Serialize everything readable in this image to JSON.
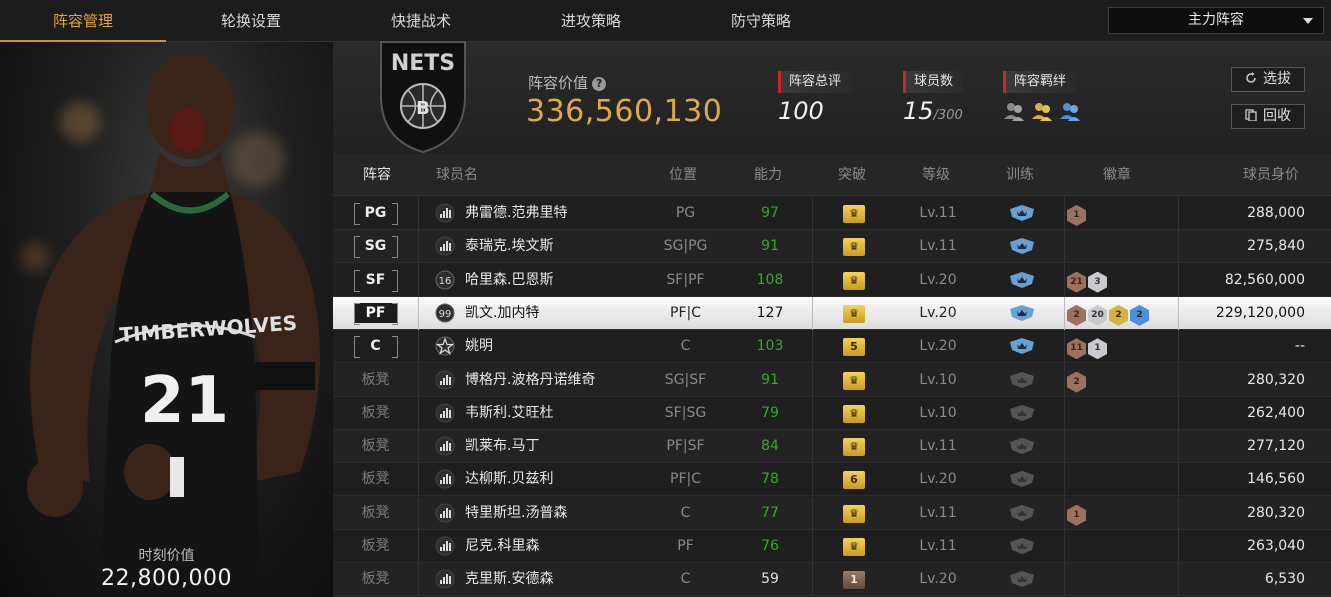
{
  "nav": {
    "tabs": [
      "阵容管理",
      "轮换设置",
      "快捷战术",
      "进攻策略",
      "防守策略"
    ],
    "active_index": 0,
    "lineup_select": "主力阵容"
  },
  "portrait": {
    "moment_label": "时刻价值",
    "moment_value": "22,800,000"
  },
  "header": {
    "value_label": "阵容价值",
    "value_number": "336,560,130",
    "rating_label": "阵容总评",
    "rating_value": "100",
    "players_label": "球员数",
    "players_value": "15",
    "players_max": "/300",
    "bond_label": "阵容羁绊",
    "scout_button": "选拔",
    "recycle_button": "回收"
  },
  "table": {
    "headers": [
      "阵容",
      "球员名",
      "位置",
      "能力",
      "突破",
      "等级",
      "训练",
      "徽章",
      "球员身价"
    ],
    "rows": [
      {
        "slot": "PG",
        "starter": true,
        "signal": "bars",
        "name": "弗雷德.范弗里特",
        "pos": "PG",
        "ability": "97",
        "ability_color": "green",
        "breakthrough": "crown",
        "level": "Lv.11",
        "train": "blue",
        "badges": [
          {
            "tier": "bronze",
            "text": "1"
          }
        ],
        "price": "288,000"
      },
      {
        "slot": "SG",
        "starter": true,
        "signal": "bars",
        "name": "泰瑞克.埃文斯",
        "pos": "SG|PG",
        "ability": "91",
        "ability_color": "green",
        "breakthrough": "crown",
        "level": "Lv.11",
        "train": "blue",
        "badges": [],
        "price": "275,840"
      },
      {
        "slot": "SF",
        "starter": true,
        "signal": "16",
        "name": "哈里森.巴恩斯",
        "pos": "SF|PF",
        "ability": "108",
        "ability_color": "green",
        "breakthrough": "crown",
        "level": "Lv.20",
        "train": "blue",
        "badges": [
          {
            "tier": "bronze",
            "text": "21"
          },
          {
            "tier": "silver",
            "text": "3"
          }
        ],
        "price": "82,560,000"
      },
      {
        "slot": "PF",
        "starter": true,
        "selected": true,
        "signal": "99",
        "name": "凯文.加内特",
        "pos": "PF|C",
        "ability": "127",
        "ability_color": "white",
        "breakthrough": "crown",
        "level": "Lv.20",
        "train": "blue",
        "badges": [
          {
            "tier": "bronze",
            "text": "2"
          },
          {
            "tier": "silver",
            "text": "20"
          },
          {
            "tier": "gold",
            "text": "2"
          },
          {
            "tier": "blue",
            "text": "2"
          }
        ],
        "price": "229,120,000"
      },
      {
        "slot": "C",
        "starter": true,
        "signal": "star",
        "name": "姚明",
        "pos": "C",
        "ability": "103",
        "ability_color": "green",
        "breakthrough": "5",
        "level": "Lv.20",
        "train": "blue",
        "badges": [
          {
            "tier": "bronze",
            "text": "11"
          },
          {
            "tier": "silver",
            "text": "1"
          }
        ],
        "price": "--"
      },
      {
        "slot": "板凳",
        "starter": false,
        "signal": "bars",
        "name": "博格丹.波格丹诺维奇",
        "pos": "SG|SF",
        "ability": "91",
        "ability_color": "green",
        "breakthrough": "crown",
        "level": "Lv.10",
        "train": "grey",
        "badges": [
          {
            "tier": "bronze",
            "text": "2"
          }
        ],
        "price": "280,320"
      },
      {
        "slot": "板凳",
        "starter": false,
        "signal": "bars",
        "name": "韦斯利.艾旺杜",
        "pos": "SF|SG",
        "ability": "79",
        "ability_color": "green",
        "breakthrough": "crown",
        "level": "Lv.10",
        "train": "grey",
        "badges": [],
        "price": "262,400"
      },
      {
        "slot": "板凳",
        "starter": false,
        "signal": "bars",
        "name": "凯莱布.马丁",
        "pos": "PF|SF",
        "ability": "84",
        "ability_color": "green",
        "breakthrough": "crown",
        "level": "Lv.11",
        "train": "grey",
        "badges": [],
        "price": "277,120"
      },
      {
        "slot": "板凳",
        "starter": false,
        "signal": "bars",
        "name": "达柳斯.贝兹利",
        "pos": "PF|C",
        "ability": "78",
        "ability_color": "green",
        "breakthrough": "6",
        "level": "Lv.20",
        "train": "grey",
        "badges": [],
        "price": "146,560"
      },
      {
        "slot": "板凳",
        "starter": false,
        "signal": "bars",
        "name": "特里斯坦.汤普森",
        "pos": "C",
        "ability": "77",
        "ability_color": "green",
        "breakthrough": "crown",
        "level": "Lv.11",
        "train": "grey",
        "badges": [
          {
            "tier": "bronze",
            "text": "1"
          }
        ],
        "price": "280,320"
      },
      {
        "slot": "板凳",
        "starter": false,
        "signal": "bars",
        "name": "尼克.科里森",
        "pos": "PF",
        "ability": "76",
        "ability_color": "green",
        "breakthrough": "crown",
        "level": "Lv.11",
        "train": "grey",
        "badges": [],
        "price": "263,040"
      },
      {
        "slot": "板凳",
        "starter": false,
        "signal": "bars",
        "name": "克里斯.安德森",
        "pos": "C",
        "ability": "59",
        "ability_color": "white",
        "breakthrough": "1",
        "breakthrough_tier": "bronze",
        "level": "Lv.20",
        "train": "grey",
        "badges": [],
        "price": "6,530"
      }
    ]
  },
  "colors": {
    "accent_gold": "#e0a84a",
    "ability_green": "#3aa62e",
    "label_red": "#c62828"
  }
}
